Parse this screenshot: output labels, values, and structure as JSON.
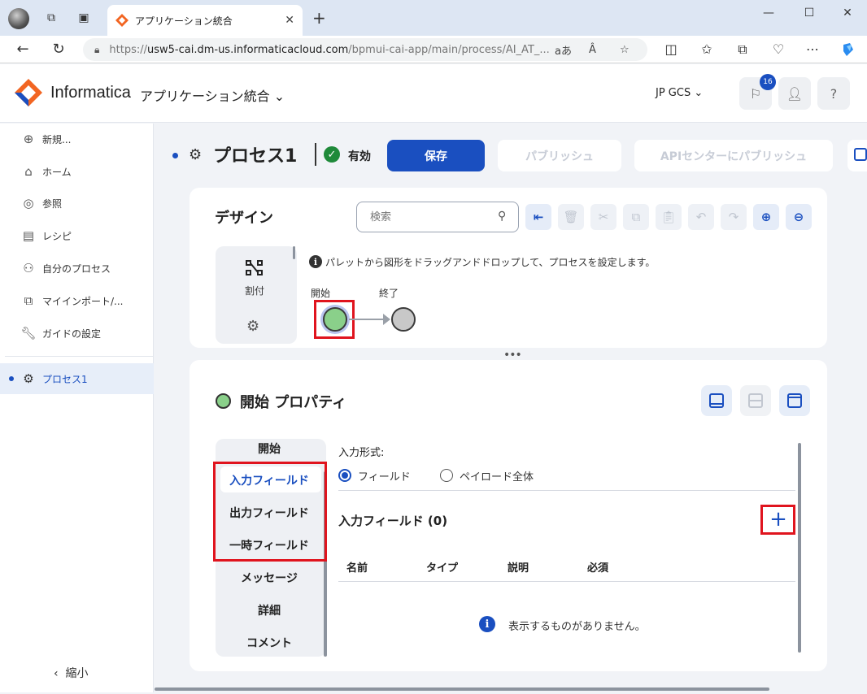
{
  "browser": {
    "tab_title": "アプリケーション統合",
    "url_prefix": "https://",
    "url_host": "usw5-cai.dm-us.informaticacloud.com",
    "url_rest": "/bpmui-cai-app/main/process/AI_AT_...",
    "reader_label": "aあ",
    "read_aloud_label": "Â"
  },
  "header": {
    "brand": "Informatica",
    "app_name": "アプリケーション統合 ⌄",
    "org": "JP GCS ⌄",
    "notif_count": "16",
    "help": "?"
  },
  "sidebar": {
    "new": "新規...",
    "home": "ホーム",
    "explore": "参照",
    "recipe": "レシピ",
    "my_process": "自分のプロセス",
    "my_import": "マイインポート/...",
    "guide": "ガイドの設定",
    "open_process": "プロセス1",
    "collapse": "縮小"
  },
  "process": {
    "title": "プロセス1",
    "status": "有効",
    "save": "保存",
    "publish": "パブリッシュ",
    "publish_api": "APIセンターにパブリッシュ"
  },
  "design": {
    "title": "デザイン",
    "search_placeholder": "検索",
    "palette_label": "割付",
    "hint": "パレットから図形をドラッグアンドドロップして、プロセスを設定します。",
    "start_label": "開始",
    "end_label": "終了"
  },
  "properties": {
    "title": "開始 プロパティ",
    "tabs": [
      "開始",
      "入力フィールド",
      "出力フィールド",
      "一時フィールド",
      "メッセージ",
      "詳細",
      "コメント"
    ],
    "input_format_label": "入力形式:",
    "radio_fields": "フィールド",
    "radio_payload": "ペイロード全体",
    "fields_title": "入力フィールド (0)",
    "columns": [
      "名前",
      "タイプ",
      "説明",
      "必須"
    ],
    "empty_message": "表示するものがありません。"
  },
  "colors": {
    "accent": "#1a4fc0",
    "highlight": "#e0141e",
    "start_node": "#8ad08a",
    "end_node": "#c8c8c8",
    "valid": "#1f8a3a"
  }
}
